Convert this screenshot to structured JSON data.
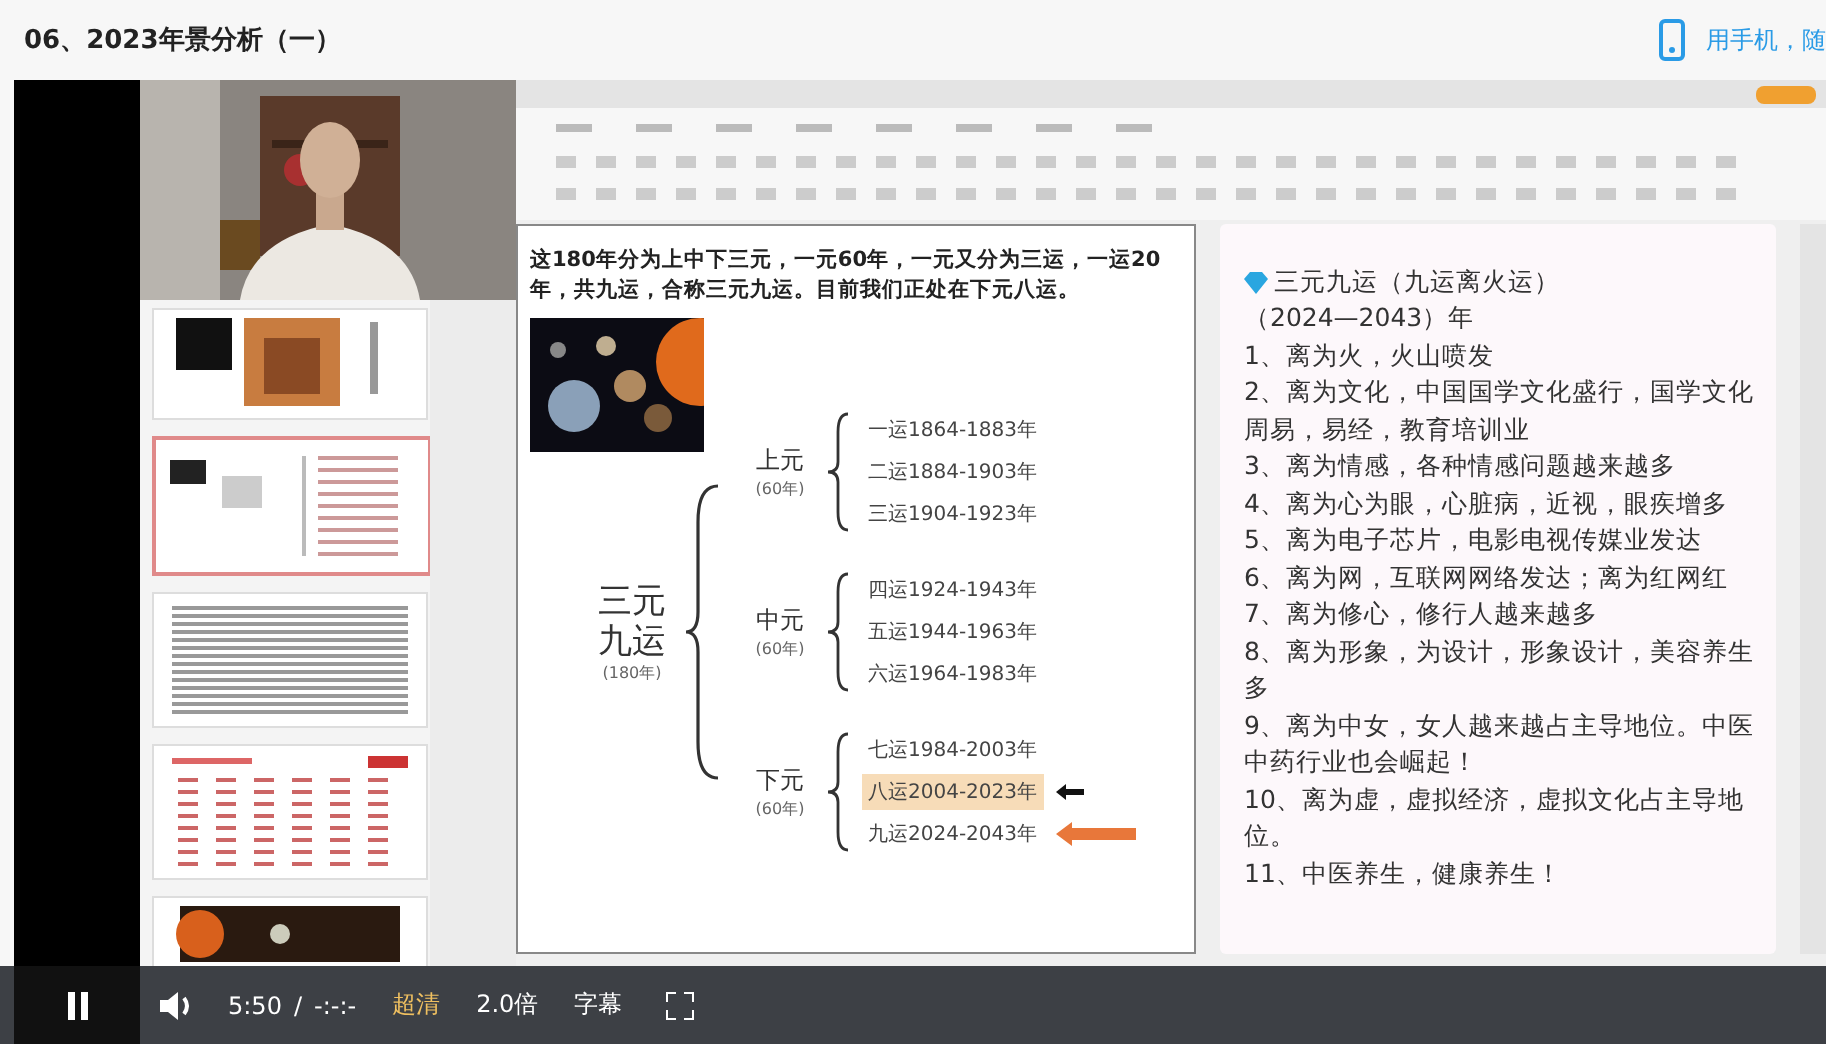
{
  "page": {
    "title": "06、2023年景分析（一）",
    "mobile_link": "用手机，随"
  },
  "thumbnails": [
    {
      "kind": "images",
      "selected": false
    },
    {
      "kind": "slide",
      "selected": true
    },
    {
      "kind": "text-grid",
      "selected": false
    },
    {
      "kind": "table",
      "selected": false
    },
    {
      "kind": "banner",
      "selected": false
    }
  ],
  "slide": {
    "intro": "这180年分为上中下三元，一元60年，一元又分为三运，一运20年，共九运，合称三元九运。目前我们正处在下元八运。",
    "root": {
      "label_lines": [
        "三元",
        "九运"
      ],
      "sub": "(180年)"
    },
    "groups": [
      {
        "label": "上元",
        "sub": "(60年)",
        "items": [
          {
            "text": "一运1864-1883年",
            "highlighted": false
          },
          {
            "text": "二运1884-1903年",
            "highlighted": false
          },
          {
            "text": "三运1904-1923年",
            "highlighted": false
          }
        ]
      },
      {
        "label": "中元",
        "sub": "(60年)",
        "items": [
          {
            "text": "四运1924-1943年",
            "highlighted": false
          },
          {
            "text": "五运1944-1963年",
            "highlighted": false
          },
          {
            "text": "六运1964-1983年",
            "highlighted": false
          }
        ]
      },
      {
        "label": "下元",
        "sub": "(60年)",
        "items": [
          {
            "text": "七运1984-2003年",
            "highlighted": false
          },
          {
            "text": "八运2004-2023年",
            "highlighted": true,
            "arrow": {
              "kind": "short",
              "color": "#111111"
            }
          },
          {
            "text": "九运2024-2043年",
            "highlighted": false,
            "arrow": {
              "kind": "long",
              "color": "#e8773a"
            }
          }
        ]
      }
    ]
  },
  "card": {
    "title": "三元九运（九运离火运）",
    "subtitle": "（2024—2043）年",
    "lines": [
      "1、离为火，火山喷发",
      "2、离为文化，中国国学文化盛行，国学文化周易，易经，教育培训业",
      "3、离为情感，各种情感问题越来越多",
      "4、离为心为眼，心脏病，近视，眼疾增多",
      "5、离为电子芯片，电影电视传媒业发达",
      "6、离为网，互联网网络发达；离为红网红",
      "7、离为修心，修行人越来越多",
      "8、离为形象，为设计，形象设计，美容养生多",
      "9、离为中女，女人越来越占主导地位。中医中药行业也会崛起！",
      "10、离为虚，虚拟经济，虚拟文化占主导地位。",
      "11、中医养生，健康养生！"
    ]
  },
  "controls": {
    "playing": true,
    "time": "5:50",
    "separator": "/",
    "duration": "-:-:-",
    "quality": "超清",
    "speed": "2.0倍",
    "subtitles": "字幕"
  }
}
